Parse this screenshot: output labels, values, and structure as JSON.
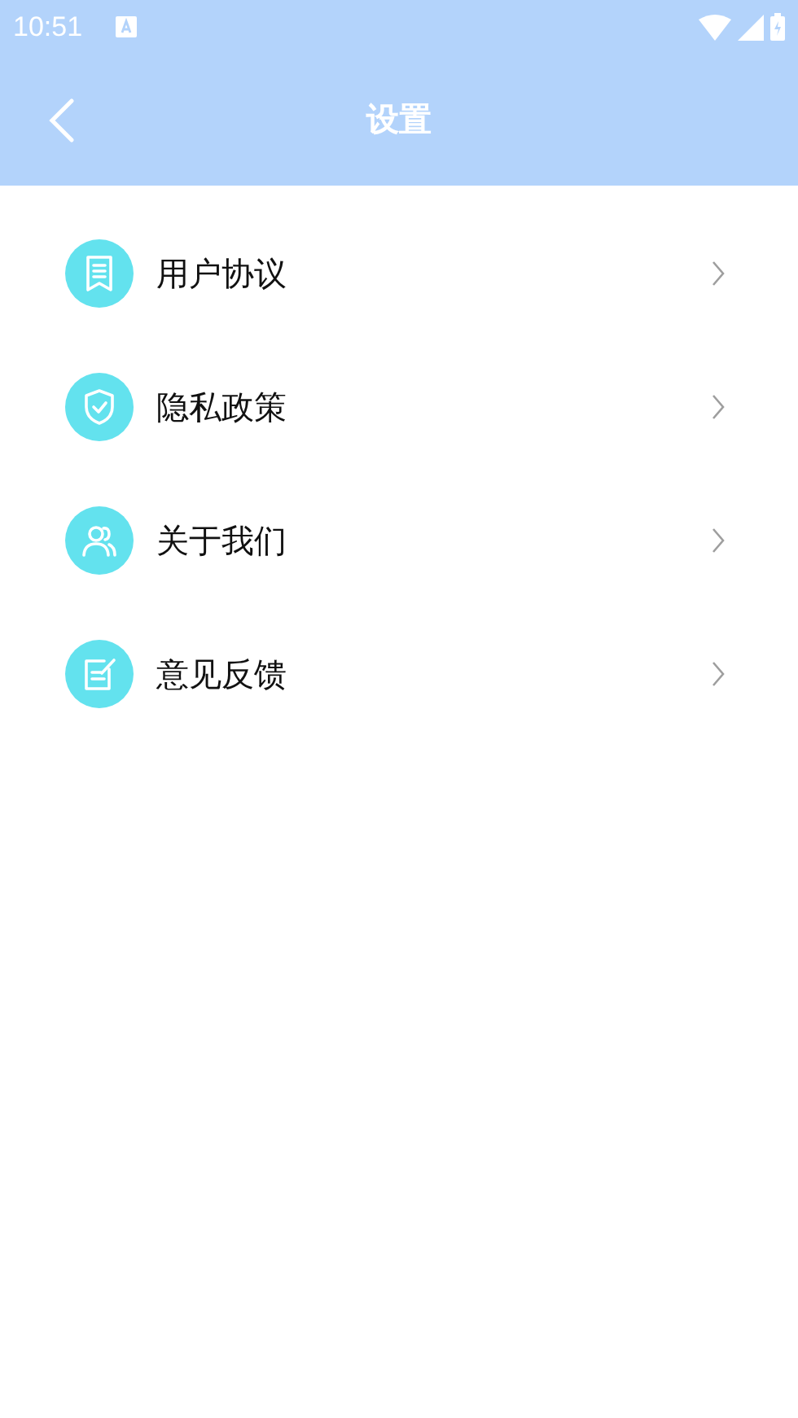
{
  "status_bar": {
    "time": "10:51"
  },
  "header": {
    "title": "设置"
  },
  "items": [
    {
      "label": "用户协议",
      "kind": "document"
    },
    {
      "label": "隐私政策",
      "kind": "shield"
    },
    {
      "label": "关于我们",
      "kind": "people"
    },
    {
      "label": "意见反馈",
      "kind": "edit"
    }
  ]
}
